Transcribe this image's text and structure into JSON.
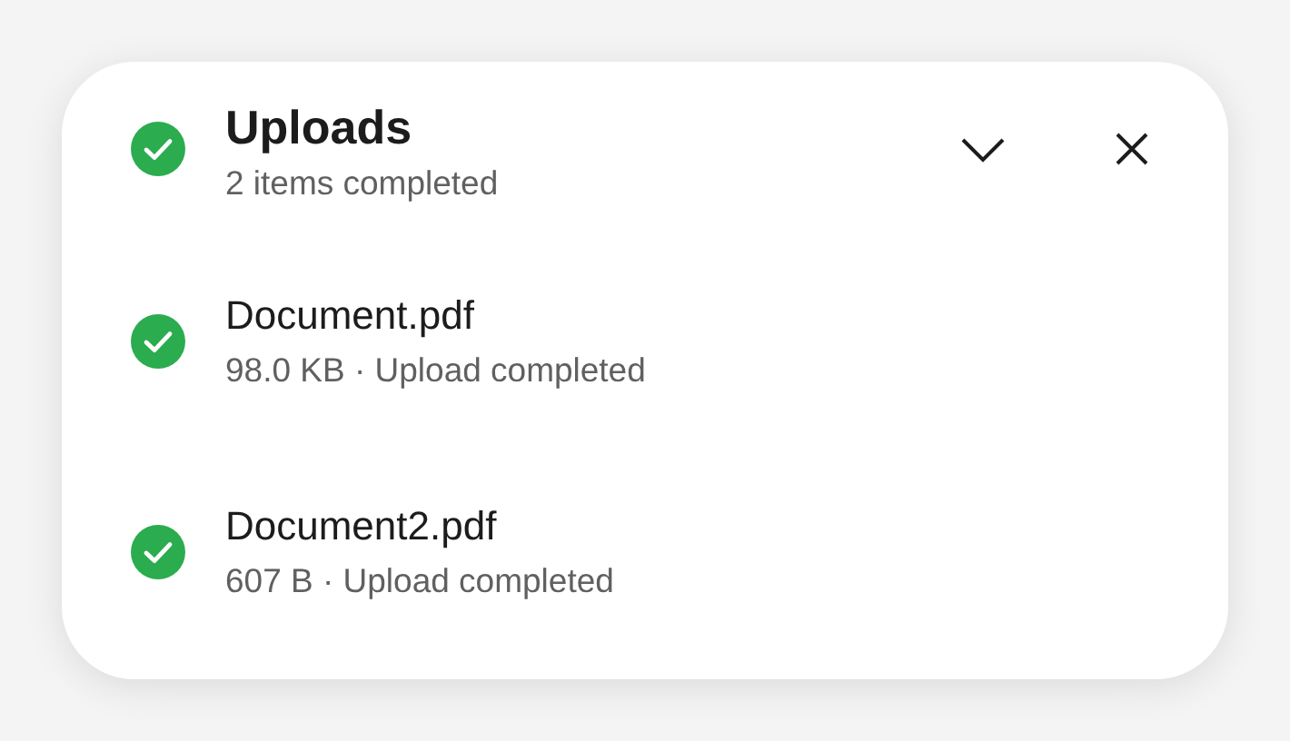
{
  "header": {
    "title": "Uploads",
    "subtitle": "2 items completed",
    "done": true,
    "expanded": true
  },
  "files": [
    {
      "name": "Document.pdf",
      "detail": "98.0 KB · Upload completed",
      "done": true
    },
    {
      "name": "Document2.pdf",
      "detail": "607 B · Upload completed",
      "done": true
    }
  ]
}
